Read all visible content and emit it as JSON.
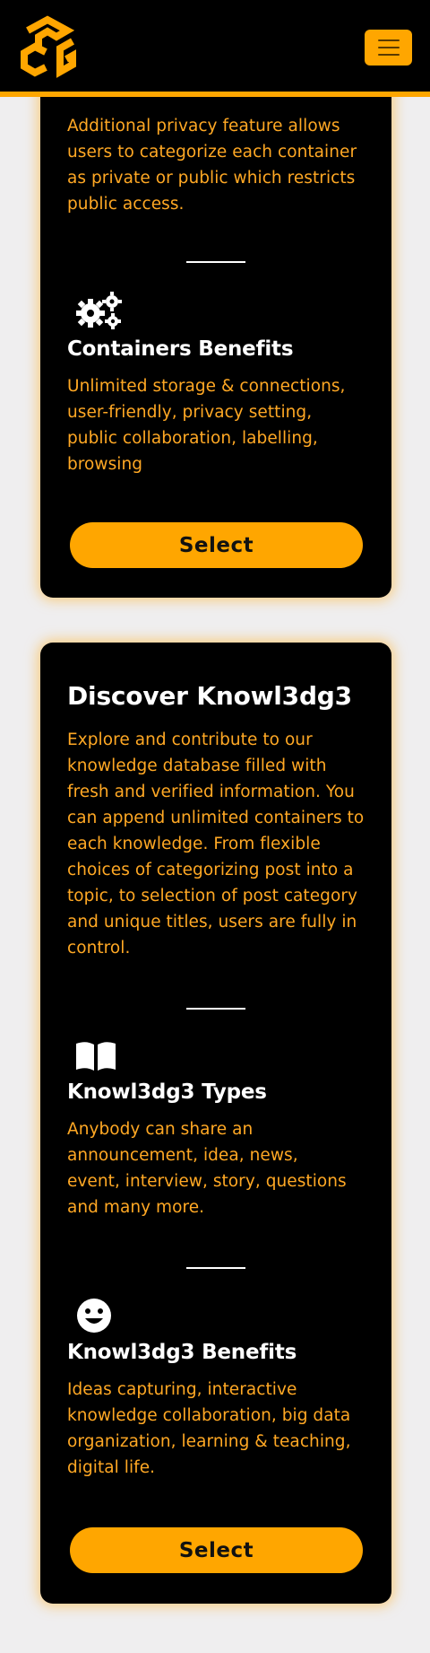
{
  "header": {
    "logo_alt": "PCG logo",
    "menu_icon": "hamburger-menu-icon"
  },
  "colors": {
    "accent": "#ffa600",
    "card_bg": "#000000",
    "body_text": "#ffa824",
    "heading_text": "#ffffff",
    "page_bg": "#efeeef"
  },
  "containers_card": {
    "privacy_text": "Additional privacy feature allows users to categorize each container as private or public which restricts public access.",
    "benefits": {
      "icon": "gears-icon",
      "title": "Containers Benefits",
      "text": "Unlimited storage & connections, user-friendly, privacy setting, public collaboration, labelling, browsing"
    },
    "select_label": "Select"
  },
  "knowledge_card": {
    "title": "Discover Knowl3dg3",
    "description": "Explore and contribute to our knowledge database filled with fresh and verified information. You can append unlimited containers to each knowledge. From flexible choices of categorizing post into a topic, to selection of post category and unique titles, users are fully in control.",
    "types": {
      "icon": "open-book-icon",
      "title": "Knowl3dg3 Types",
      "text": "Anybody can share an announcement, idea, news, event, interview, story, questions and many more."
    },
    "benefits": {
      "icon": "smiley-face-icon",
      "title": "Knowl3dg3 Benefits",
      "text": "Ideas capturing, interactive knowledge collaboration, big data organization, learning & teaching, digital life."
    },
    "select_label": "Select"
  }
}
